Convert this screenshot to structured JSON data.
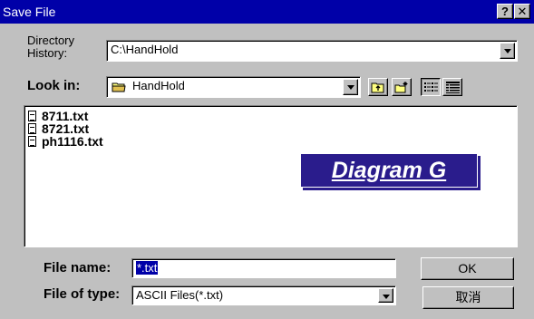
{
  "window": {
    "title": "Save File",
    "help_label": "?",
    "close_label": "✕"
  },
  "directory_history": {
    "label_line1": "Directory",
    "label_line2": "History:",
    "value": "C:\\HandHold"
  },
  "look_in": {
    "label": "Look in:",
    "value": "HandHold",
    "icons": [
      "folder-icon",
      "up-folder-icon",
      "new-folder-icon",
      "list-view-icon",
      "details-view-icon"
    ]
  },
  "files": [
    {
      "name": "8711.txt",
      "icon": "text-file-icon"
    },
    {
      "name": "8721.txt",
      "icon": "text-file-icon"
    },
    {
      "name": "ph1116.txt",
      "icon": "text-file-icon"
    }
  ],
  "annotation": {
    "text": "Diagram G"
  },
  "file_name": {
    "label": "File name:",
    "value": "*.txt"
  },
  "file_type": {
    "label": "File of type:",
    "value": "ASCII Files(*.txt)"
  },
  "buttons": {
    "ok": "OK",
    "cancel": "取消"
  },
  "colors": {
    "titlebar": "#0000a8",
    "face": "#c0c0c0",
    "annotation": "#2a1c8c"
  }
}
